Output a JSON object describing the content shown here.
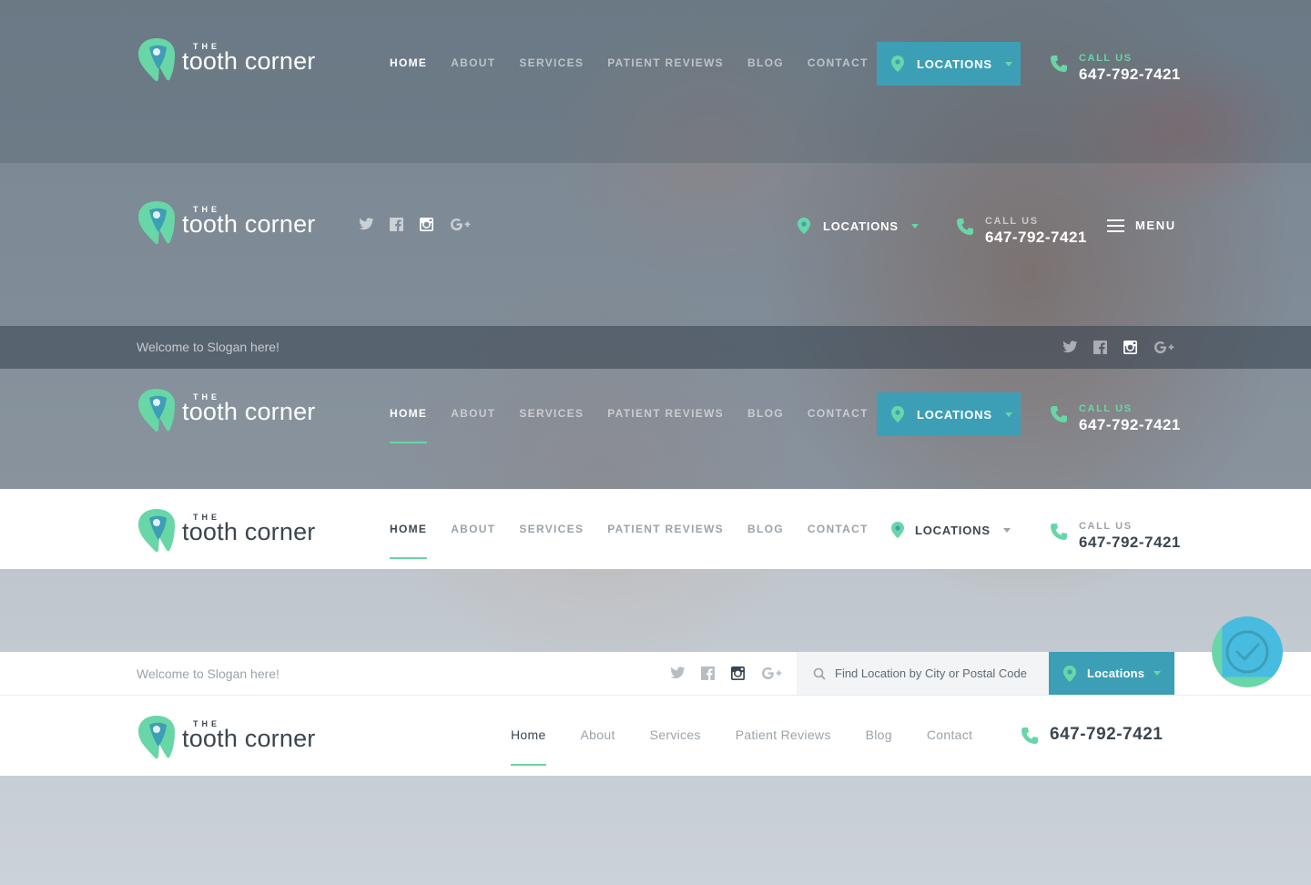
{
  "brand": {
    "the": "THE",
    "word": "tooth corner"
  },
  "colors": {
    "accent_green": "#68d6a6",
    "accent_teal": "#3d9fb6",
    "dark_text": "#3c4650",
    "muted_text": "#9aa3aa"
  },
  "nav": {
    "home": "HOME",
    "about": "ABOUT",
    "services": "SERVICES",
    "reviews": "PATIENT REVIEWS",
    "blog": "BLOG",
    "contact": "CONTACT"
  },
  "nav_case": {
    "home": "Home",
    "about": "About",
    "services": "Services",
    "reviews": "Patient Reviews",
    "blog": "Blog",
    "contact": "Contact"
  },
  "locations": {
    "label_upper": "LOCATIONS",
    "label_case": "Locations"
  },
  "call": {
    "label": "CALL US",
    "phone": "647-792-7421"
  },
  "menu": {
    "label": "MENU"
  },
  "slogan": "Welcome to Slogan here!",
  "search": {
    "placeholder": "Find Location by City or Postal Code"
  },
  "social_icons": [
    "twitter-icon",
    "facebook-icon",
    "instagram-icon",
    "google-plus-icon"
  ]
}
